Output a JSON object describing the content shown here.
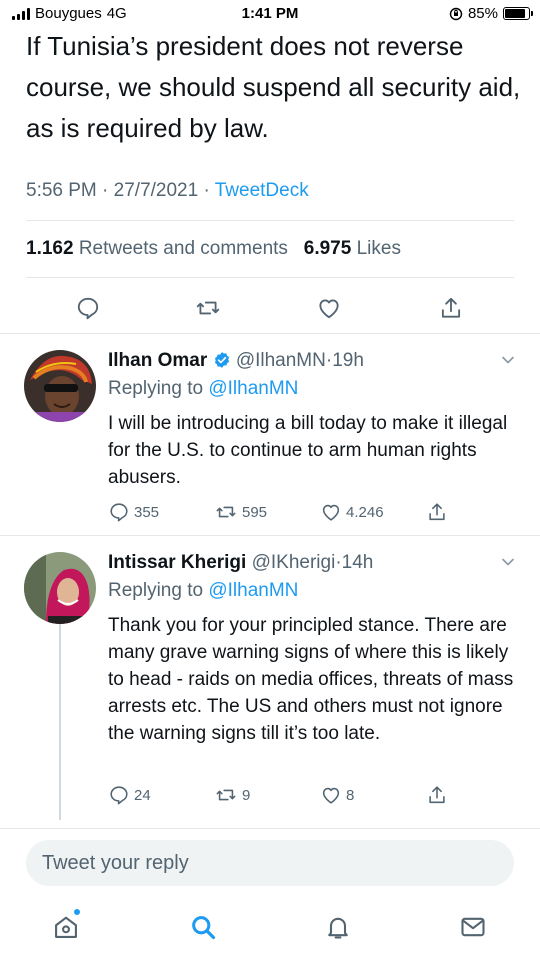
{
  "status_bar": {
    "carrier": "Bouygues",
    "network": "4G",
    "time": "1:41 PM",
    "battery": "85%",
    "battery_level": 0.85
  },
  "main_tweet": {
    "text": "If Tunisia’s president does not reverse course, we should suspend all security aid, as is required by law.",
    "time": "5:56 PM",
    "date": "27/7/2021",
    "source": "TweetDeck",
    "separator": "·",
    "retweets_count": "1.162",
    "retweets_label": "Retweets and comments",
    "likes_count": "6.975",
    "likes_label": "Likes"
  },
  "replies": [
    {
      "name": "Ilhan Omar",
      "verified": true,
      "handle": "@IlhanMN",
      "time": "19h",
      "separator": "·",
      "replying_prefix": "Replying to",
      "replying_to": "@IlhanMN",
      "text": "I will be introducing a bill today to make it illegal for the U.S. to continue to arm human rights abusers.",
      "comments": "355",
      "retweets": "595",
      "likes": "4.246"
    },
    {
      "name": "Intissar Kherigi",
      "verified": false,
      "handle": "@IKherigi",
      "time": "14h",
      "separator": "·",
      "replying_prefix": "Replying to",
      "replying_to": "@IlhanMN",
      "text": "Thank you for your principled stance. There are many grave warning signs of where this is likely to head - raids on media offices, threats of mass arrests etc. The US and others must not ignore the warning signs till it’s too late.",
      "comments": "24",
      "retweets": "9",
      "likes": "8"
    }
  ],
  "composer": {
    "placeholder": "Tweet your reply"
  },
  "nav": [
    "home-icon",
    "search-icon",
    "notifications-icon",
    "messages-icon"
  ],
  "colors": {
    "accent": "#1d9bf0",
    "muted": "#536471",
    "text": "#0f1419"
  }
}
